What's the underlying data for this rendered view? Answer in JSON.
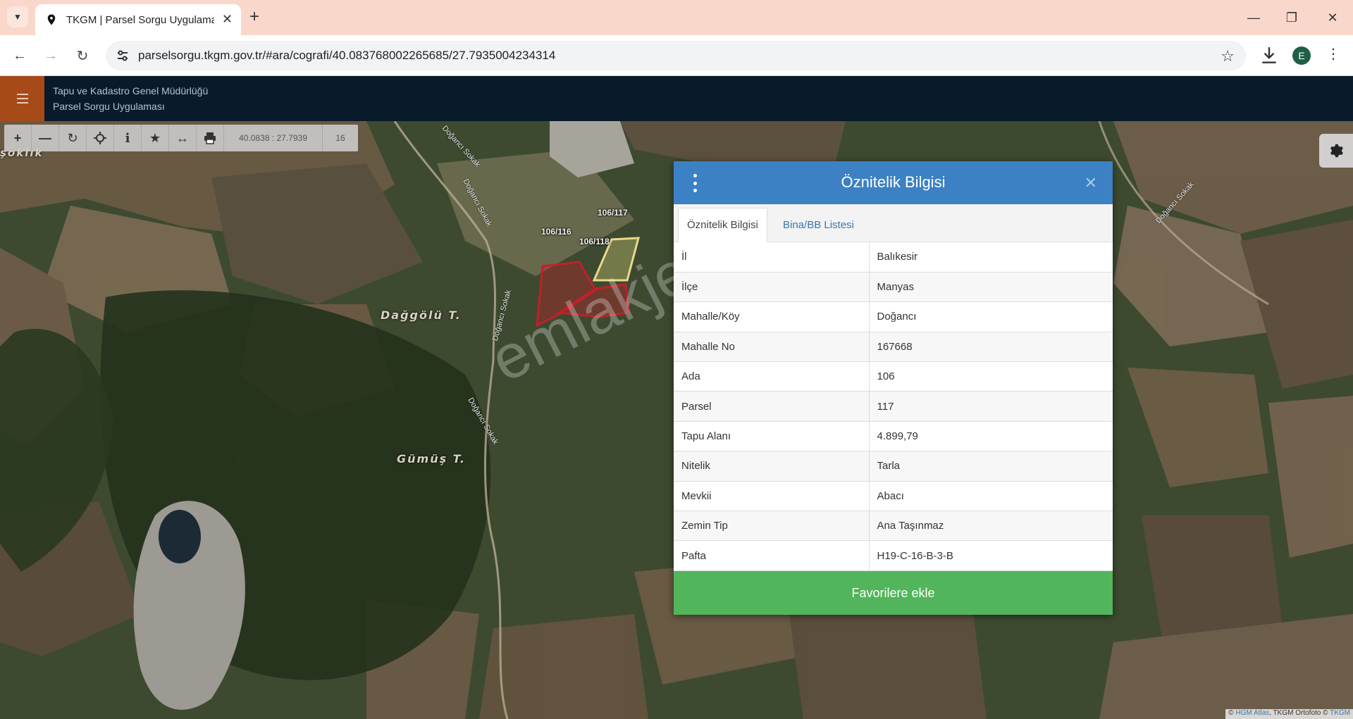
{
  "browser": {
    "tab_title": "TKGM | Parsel Sorgu Uygulaması",
    "url": "parselsorgu.tkgm.gov.tr/#ara/cografi/40.083768002265685/27.7935004234314",
    "profile_initial": "E"
  },
  "header": {
    "org_line1": "Tapu ve Kadastro Genel Müdürlüğü",
    "org_line2": "Parsel Sorgu Uygulaması"
  },
  "toolbar": {
    "coordinates": "40.0838 : 27.7939",
    "zoom": "16",
    "tools": [
      "zoom-in",
      "zoom-out",
      "refresh",
      "locate",
      "info",
      "favorites",
      "measure",
      "print"
    ]
  },
  "map": {
    "labels": [
      "Dağgölü T.",
      "Gümüş T.",
      "şoklık"
    ],
    "road_labels": [
      "Doğancı Sokak"
    ],
    "parcels": [
      "106/116",
      "106/117",
      "106/118"
    ],
    "watermark": "emlakjet.com",
    "attribution_parts": [
      "© ",
      "HGM Atlas",
      ", TKGM Ortofoto © ",
      "TKGM"
    ]
  },
  "panel": {
    "title": "Öznitelik Bilgisi",
    "tabs": [
      "Öznitelik Bilgisi",
      "Bina/BB Listesi"
    ],
    "rows": [
      {
        "key": "İl",
        "value": "Balıkesir"
      },
      {
        "key": "İlçe",
        "value": "Manyas"
      },
      {
        "key": "Mahalle/Köy",
        "value": "Doğancı"
      },
      {
        "key": "Mahalle No",
        "value": "167668"
      },
      {
        "key": "Ada",
        "value": "106"
      },
      {
        "key": "Parsel",
        "value": "117"
      },
      {
        "key": "Tapu Alanı",
        "value": "4.899,79"
      },
      {
        "key": "Nitelik",
        "value": "Tarla"
      },
      {
        "key": "Mevkii",
        "value": "Abacı"
      },
      {
        "key": "Zemin Tip",
        "value": "Ana Taşınmaz"
      },
      {
        "key": "Pafta",
        "value": "H19-C-16-B-3-B"
      }
    ],
    "fav_button": "Favorilere ekle"
  },
  "colors": {
    "panel_header": "#3b81c4",
    "fav_button": "#52b55b",
    "app_header": "#091a2a",
    "hamburger": "#a64a18",
    "parcel_selected": "#e8d98a",
    "parcel_neighbor": "#c0202a"
  }
}
